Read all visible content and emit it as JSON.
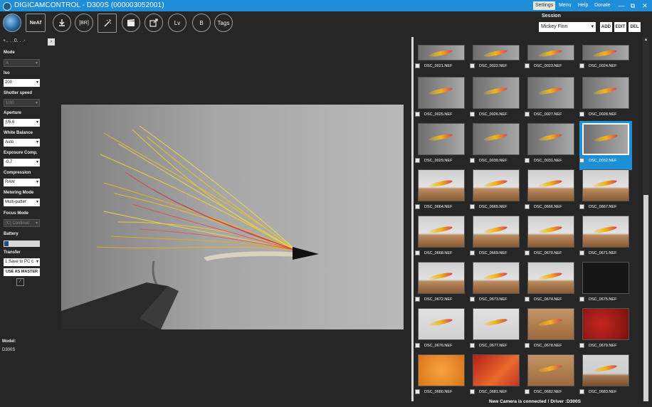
{
  "window": {
    "title": "DIGICAMCONTROL - D300S (000003052001)",
    "menu": [
      "Settings",
      "Menu",
      "Help",
      "Donate"
    ],
    "controls": [
      "—",
      "⧉",
      "✕"
    ]
  },
  "toolbar": {
    "buttons": [
      "",
      "NeAf",
      "",
      "[BR]",
      "",
      "",
      "",
      "Lv",
      "B",
      "Tags"
    ]
  },
  "session": {
    "label": "Session",
    "value": "Mickey Finn",
    "add": "ADD",
    "edit": "EDIT",
    "del": "DEL"
  },
  "exposure_scale": "+.. . .0. . .-",
  "camera": {
    "mode": {
      "label": "Mode",
      "value": "A"
    },
    "iso": {
      "label": "Iso",
      "value": "200"
    },
    "shutter": {
      "label": "Shutter speed",
      "value": "1/30"
    },
    "aperture": {
      "label": "Aperture",
      "value": "ƒ/5,6"
    },
    "wb": {
      "label": "White Balance",
      "value": "Auto"
    },
    "expcomp": {
      "label": "Exposure Comp.",
      "value": "-0.7"
    },
    "compression": {
      "label": "Compression",
      "value": "RAW"
    },
    "metering": {
      "label": "Metering Mode",
      "value": "Multi-patter"
    },
    "focus": {
      "label": "Focus Mode",
      "value": "[C] Continuo"
    },
    "battery": {
      "label": "Battery",
      "level": 0.12
    },
    "transfer": {
      "label": "Transfer",
      "value": "1.Save to PC c"
    },
    "use_as_master": "USE AS MASTER"
  },
  "model": {
    "label": "Model:",
    "value": "D300S"
  },
  "thumbnails": [
    {
      "name": "DSC_0021.NEF",
      "kind": "gray"
    },
    {
      "name": "DSC_0022.NEF",
      "kind": "gray"
    },
    {
      "name": "DSC_0023.NEF",
      "kind": "gray"
    },
    {
      "name": "DSC_0024.NEF",
      "kind": "gray"
    },
    {
      "name": "DSC_0025.NEF",
      "kind": "gray"
    },
    {
      "name": "DSC_0026.NEF",
      "kind": "gray"
    },
    {
      "name": "DSC_0027.NEF",
      "kind": "gray"
    },
    {
      "name": "DSC_0028.NEF",
      "kind": "gray"
    },
    {
      "name": "DSC_0029.NEF",
      "kind": "gray"
    },
    {
      "name": "DSC_0030.NEF",
      "kind": "gray"
    },
    {
      "name": "DSC_0031.NEF",
      "kind": "gray"
    },
    {
      "name": "DSC_0032.NEF",
      "kind": "gray",
      "selected": true
    },
    {
      "name": "DSC_0664.NEF",
      "kind": "wood"
    },
    {
      "name": "DSC_0665.NEF",
      "kind": "wood"
    },
    {
      "name": "DSC_0666.NEF",
      "kind": "wood"
    },
    {
      "name": "DSC_0667.NEF",
      "kind": "wood"
    },
    {
      "name": "DSC_0668.NEF",
      "kind": "wood"
    },
    {
      "name": "DSC_0669.NEF",
      "kind": "wood"
    },
    {
      "name": "DSC_0670.NEF",
      "kind": "wood"
    },
    {
      "name": "DSC_0671.NEF",
      "kind": "wood"
    },
    {
      "name": "DSC_0672.NEF",
      "kind": "wood"
    },
    {
      "name": "DSC_0673.NEF",
      "kind": "wood"
    },
    {
      "name": "DSC_0674.NEF",
      "kind": "wood"
    },
    {
      "name": "DSC_0675.NEF",
      "kind": "dark"
    },
    {
      "name": "DSC_0676.NEF",
      "kind": "light"
    },
    {
      "name": "DSC_0677.NEF",
      "kind": "light"
    },
    {
      "name": "DSC_0678.NEF",
      "kind": "orange-wood"
    },
    {
      "name": "DSC_0679.NEF",
      "kind": "red"
    },
    {
      "name": "DSC_0680.NEF",
      "kind": "orange"
    },
    {
      "name": "DSC_0681.NEF",
      "kind": "redorange"
    },
    {
      "name": "DSC_0682.NEF",
      "kind": "orange-wood"
    },
    {
      "name": "DSC_0683.NEF",
      "kind": "wood-flat"
    }
  ],
  "status": "New Camera is connected ! Driver :D300S",
  "colors": {
    "accent": "#1f8dd8",
    "background": "#262626"
  }
}
